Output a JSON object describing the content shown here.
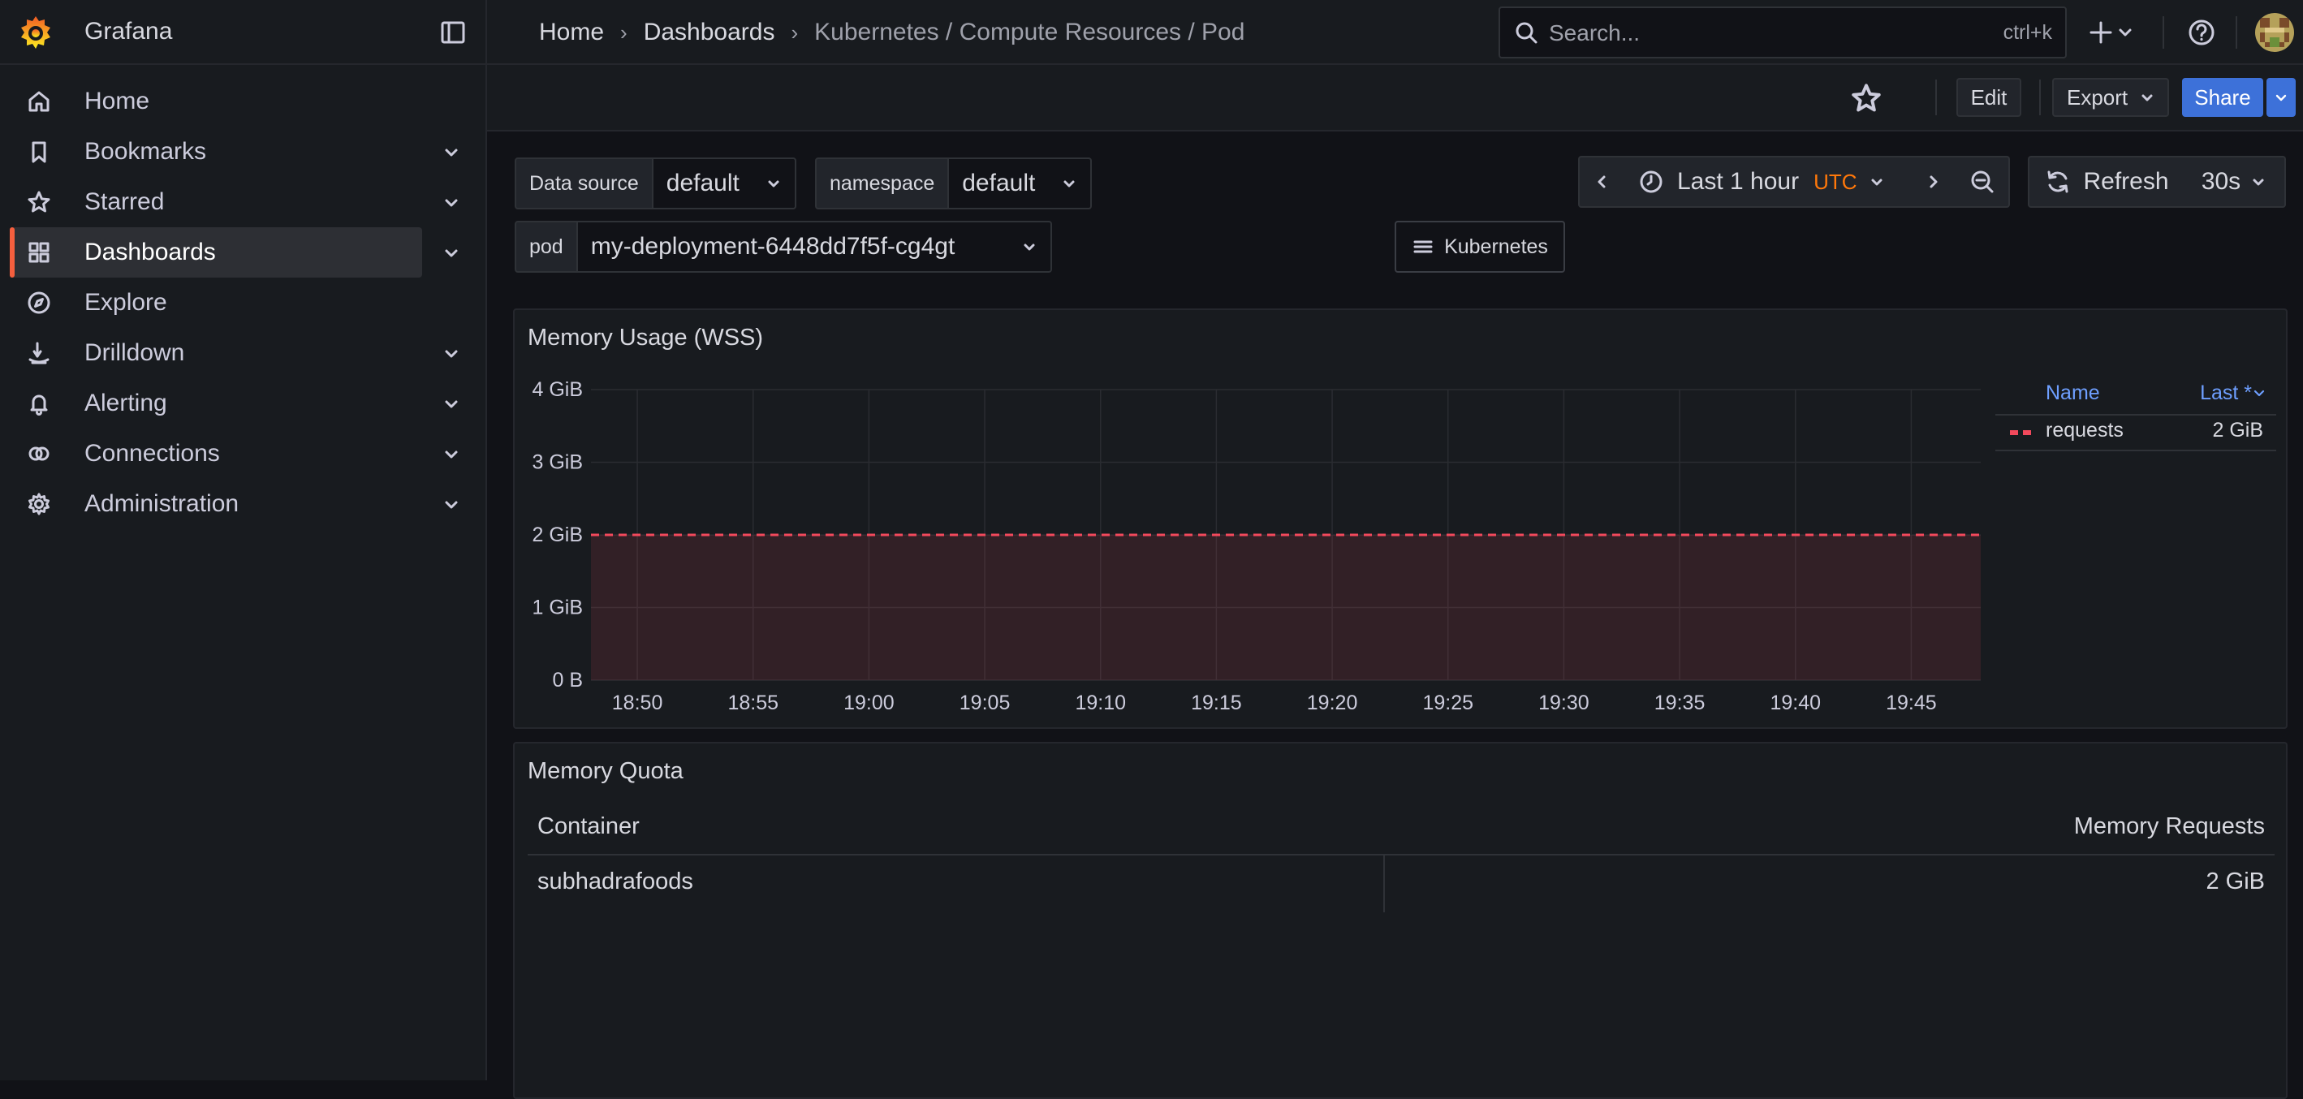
{
  "app": {
    "name": "Grafana"
  },
  "breadcrumb": {
    "items": [
      "Home",
      "Dashboards",
      "Kubernetes / Compute Resources / Pod"
    ]
  },
  "search": {
    "placeholder": "Search...",
    "shortcut": "ctrl+k"
  },
  "sidebar": {
    "items": [
      {
        "label": "Home",
        "icon": "home-icon",
        "expandable": false,
        "active": false
      },
      {
        "label": "Bookmarks",
        "icon": "bookmark-icon",
        "expandable": true,
        "active": false
      },
      {
        "label": "Starred",
        "icon": "star-icon",
        "expandable": true,
        "active": false
      },
      {
        "label": "Dashboards",
        "icon": "apps-icon",
        "expandable": true,
        "active": true
      },
      {
        "label": "Explore",
        "icon": "compass-icon",
        "expandable": false,
        "active": false
      },
      {
        "label": "Drilldown",
        "icon": "drilldown-icon",
        "expandable": true,
        "active": false
      },
      {
        "label": "Alerting",
        "icon": "bell-icon",
        "expandable": true,
        "active": false
      },
      {
        "label": "Connections",
        "icon": "link-icon",
        "expandable": true,
        "active": false
      },
      {
        "label": "Administration",
        "icon": "cog-icon",
        "expandable": true,
        "active": false
      }
    ]
  },
  "toolbar": {
    "edit_label": "Edit",
    "export_label": "Export",
    "share_label": "Share"
  },
  "variables": {
    "datasource": {
      "label": "Data source",
      "value": "default"
    },
    "namespace": {
      "label": "namespace",
      "value": "default"
    },
    "pod": {
      "label": "pod",
      "value": "my-deployment-6448dd7f5f-cg4gt"
    }
  },
  "links": {
    "kubernetes_label": "Kubernetes"
  },
  "time": {
    "range_label": "Last 1 hour",
    "timezone": "UTC",
    "refresh_label": "Refresh",
    "interval": "30s"
  },
  "panels": {
    "memory": {
      "title": "Memory Usage (WSS)",
      "legend": {
        "name_header": "Name",
        "last_header": "Last *",
        "series": "requests",
        "last_value": "2 GiB"
      }
    },
    "quota": {
      "title": "Memory Quota",
      "columns": [
        "Container",
        "Memory Requests"
      ],
      "rows": [
        [
          "subhadrafoods",
          "2 GiB"
        ]
      ]
    }
  },
  "colors": {
    "accent": "#3d71d9",
    "series_requests": "#f2495c",
    "active_nav": "#f55f3e",
    "timezone": "#ff780a"
  },
  "chart_data": {
    "type": "line",
    "title": "Memory Usage (WSS)",
    "x_ticks": [
      "18:50",
      "18:55",
      "19:00",
      "19:05",
      "19:10",
      "19:15",
      "19:20",
      "19:25",
      "19:30",
      "19:35",
      "19:40",
      "19:45"
    ],
    "y_ticks": [
      "0 B",
      "1 GiB",
      "2 GiB",
      "3 GiB",
      "4 GiB"
    ],
    "ylim_gib": [
      0,
      4
    ],
    "series": [
      {
        "name": "requests",
        "style": "dashed",
        "fill": true,
        "color": "#f2495c",
        "x": [
          "18:48",
          "19:48"
        ],
        "values_gib": [
          2,
          2
        ]
      }
    ],
    "grid": true,
    "legend_placement": "right"
  }
}
